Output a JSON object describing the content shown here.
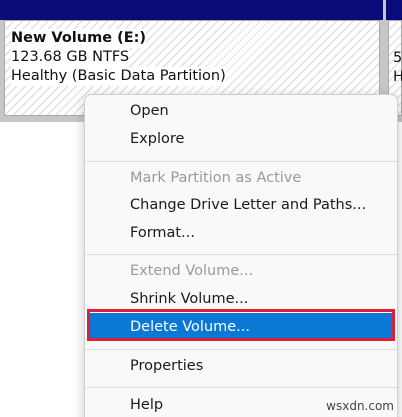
{
  "volumes": [
    {
      "name": "New Volume  (E:)",
      "size": "123.68 GB NTFS",
      "status": "Healthy (Basic Data Partition)"
    },
    {
      "size_partial": "5",
      "status_partial": "H"
    }
  ],
  "context_menu": {
    "items": [
      {
        "label": "Open"
      },
      {
        "label": "Explore"
      },
      {
        "label": "Mark Partition as Active"
      },
      {
        "label": "Change Drive Letter and Paths..."
      },
      {
        "label": "Format..."
      },
      {
        "label": "Extend Volume..."
      },
      {
        "label": "Shrink Volume..."
      },
      {
        "label": "Delete Volume..."
      },
      {
        "label": "Properties"
      },
      {
        "label": "Help"
      }
    ]
  },
  "watermark": "wsxdn.com",
  "colors": {
    "header": "#0a0a78",
    "selected": "#0b78d6",
    "highlight_box": "#d9213a"
  }
}
